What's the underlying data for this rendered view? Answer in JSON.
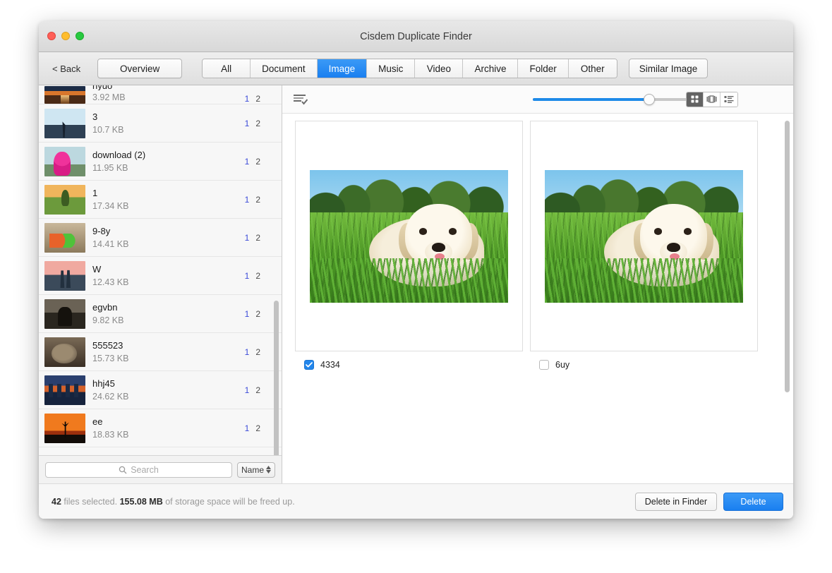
{
  "window": {
    "title": "Cisdem Duplicate Finder",
    "traffic_lights": [
      "close-button",
      "minimize-button",
      "maximize-button"
    ]
  },
  "toolbar": {
    "back_label": "< Back",
    "overview_label": "Overview",
    "tabs": [
      {
        "label": "All",
        "active": false
      },
      {
        "label": "Document",
        "active": false
      },
      {
        "label": "Image",
        "active": true
      },
      {
        "label": "Music",
        "active": false
      },
      {
        "label": "Video",
        "active": false
      },
      {
        "label": "Archive",
        "active": false
      },
      {
        "label": "Folder",
        "active": false
      },
      {
        "label": "Other",
        "active": false
      }
    ],
    "similar_image_label": "Similar Image",
    "active_tab_color": "#1a7ff0"
  },
  "sidebar": {
    "items": [
      {
        "name": "hyuo",
        "size": "3.92 MB",
        "count_selected": "1",
        "count_total": "2",
        "thumb": "road"
      },
      {
        "name": "3",
        "size": "10.7 KB",
        "count_selected": "1",
        "count_total": "2",
        "thumb": "dusk"
      },
      {
        "name": "download (2)",
        "size": "11.95 KB",
        "count_selected": "1",
        "count_total": "2",
        "thumb": "pink"
      },
      {
        "name": "1",
        "size": "17.34 KB",
        "count_selected": "1",
        "count_total": "2",
        "thumb": "tree"
      },
      {
        "name": "9-8y",
        "size": "14.41 KB",
        "count_selected": "1",
        "count_total": "2",
        "thumb": "puzzle"
      },
      {
        "name": "W",
        "size": "12.43 KB",
        "count_selected": "1",
        "count_total": "2",
        "thumb": "couple"
      },
      {
        "name": "egvbn",
        "size": "9.82 KB",
        "count_selected": "1",
        "count_total": "2",
        "thumb": "dark"
      },
      {
        "name": "555523",
        "size": "15.73 KB",
        "count_selected": "1",
        "count_total": "2",
        "thumb": "cat"
      },
      {
        "name": "hhj45",
        "size": "24.62 KB",
        "count_selected": "1",
        "count_total": "2",
        "thumb": "city"
      },
      {
        "name": "ee",
        "size": "18.83 KB",
        "count_selected": "1",
        "count_total": "2",
        "thumb": "sunset"
      }
    ],
    "search_placeholder": "Search",
    "search_value": "",
    "sort_label": "Name"
  },
  "main": {
    "zoom_slider_percent": "75",
    "view_modes": [
      {
        "name": "grid-view",
        "active": true
      },
      {
        "name": "coverflow-view",
        "active": false
      },
      {
        "name": "list-view",
        "active": false
      }
    ],
    "cards": [
      {
        "label": "4334",
        "checked": true
      },
      {
        "label": "6uy",
        "checked": false
      }
    ]
  },
  "statusbar": {
    "files_count": "42",
    "files_text": " files selected. ",
    "size_freed": "155.08 MB",
    "suffix_text": " of storage space will be freed up.",
    "delete_in_finder_label": "Delete in Finder",
    "delete_label": "Delete",
    "delete_button_color": "#1a7ff0"
  }
}
